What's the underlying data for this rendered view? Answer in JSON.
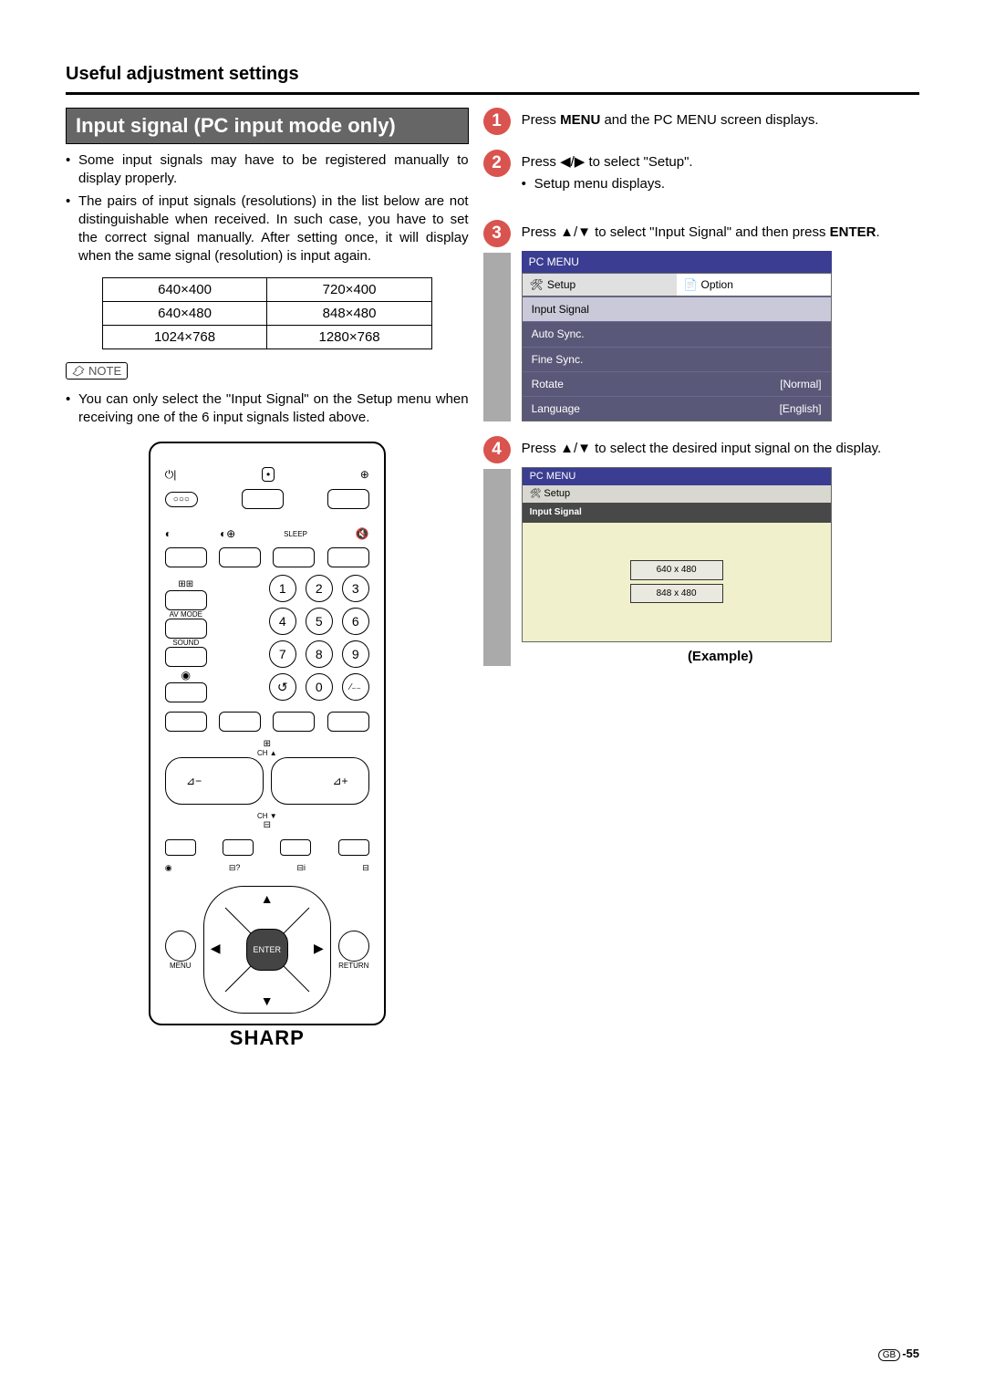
{
  "sectionTitle": "Useful adjustment settings",
  "heading": "Input signal (PC input mode only)",
  "bullets": [
    "Some input signals may have to be registered manually to display properly.",
    "The pairs of input signals (resolutions) in the list below are not distinguishable when received. In such case, you have to set the correct signal manually. After setting once, it will display when the same signal (resolution) is input again."
  ],
  "resolutions": [
    [
      "640×400",
      "720×400"
    ],
    [
      "640×480",
      "848×480"
    ],
    [
      "1024×768",
      "1280×768"
    ]
  ],
  "noteLabel": "NOTE",
  "noteText": "You can only select the \"Input Signal\" on the Setup menu when receiving one of the 6 input signals listed above.",
  "remote": {
    "sleep": "SLEEP",
    "avmode": "AV MODE",
    "sound": "SOUND",
    "ch": "CH",
    "chUp": "CH ▲",
    "chDown": "CH ▼",
    "menu": "MENU",
    "return": "RETURN",
    "enter": "ENTER",
    "brand": "SHARP",
    "numbers": [
      "1",
      "2",
      "3",
      "4",
      "5",
      "6",
      "7",
      "8",
      "9",
      "0"
    ]
  },
  "steps": [
    {
      "num": "1",
      "body_pre": "Press ",
      "body_bold": "MENU",
      "body_post": " and the PC MENU screen displays."
    },
    {
      "num": "2",
      "body_pre": "Press ◀/▶ to select \"Setup\".",
      "sub": "Setup menu displays."
    },
    {
      "num": "3",
      "body_pre": "Press ▲/▼ to select \"Input Signal\" and then press ",
      "body_bold": "ENTER",
      "body_post": "."
    },
    {
      "num": "4",
      "body_pre": "Press ▲/▼ to select the desired input signal on the display."
    }
  ],
  "pcMenu": {
    "title": "PC MENU",
    "tabs": {
      "setup": "Setup",
      "option": "Option"
    },
    "items": [
      {
        "label": "Input Signal",
        "value": ""
      },
      {
        "label": "Auto Sync.",
        "value": ""
      },
      {
        "label": "Fine Sync.",
        "value": ""
      },
      {
        "label": "Rotate",
        "value": "[Normal]"
      },
      {
        "label": "Language",
        "value": "[English]"
      }
    ]
  },
  "pcMenu2": {
    "title": "PC MENU",
    "tab": "Setup",
    "sub": "Input Signal",
    "options": [
      "640 x 480",
      "848 x 480"
    ]
  },
  "exampleLabel": "(Example)",
  "pageRegion": "GB",
  "pageNumber": "-55"
}
